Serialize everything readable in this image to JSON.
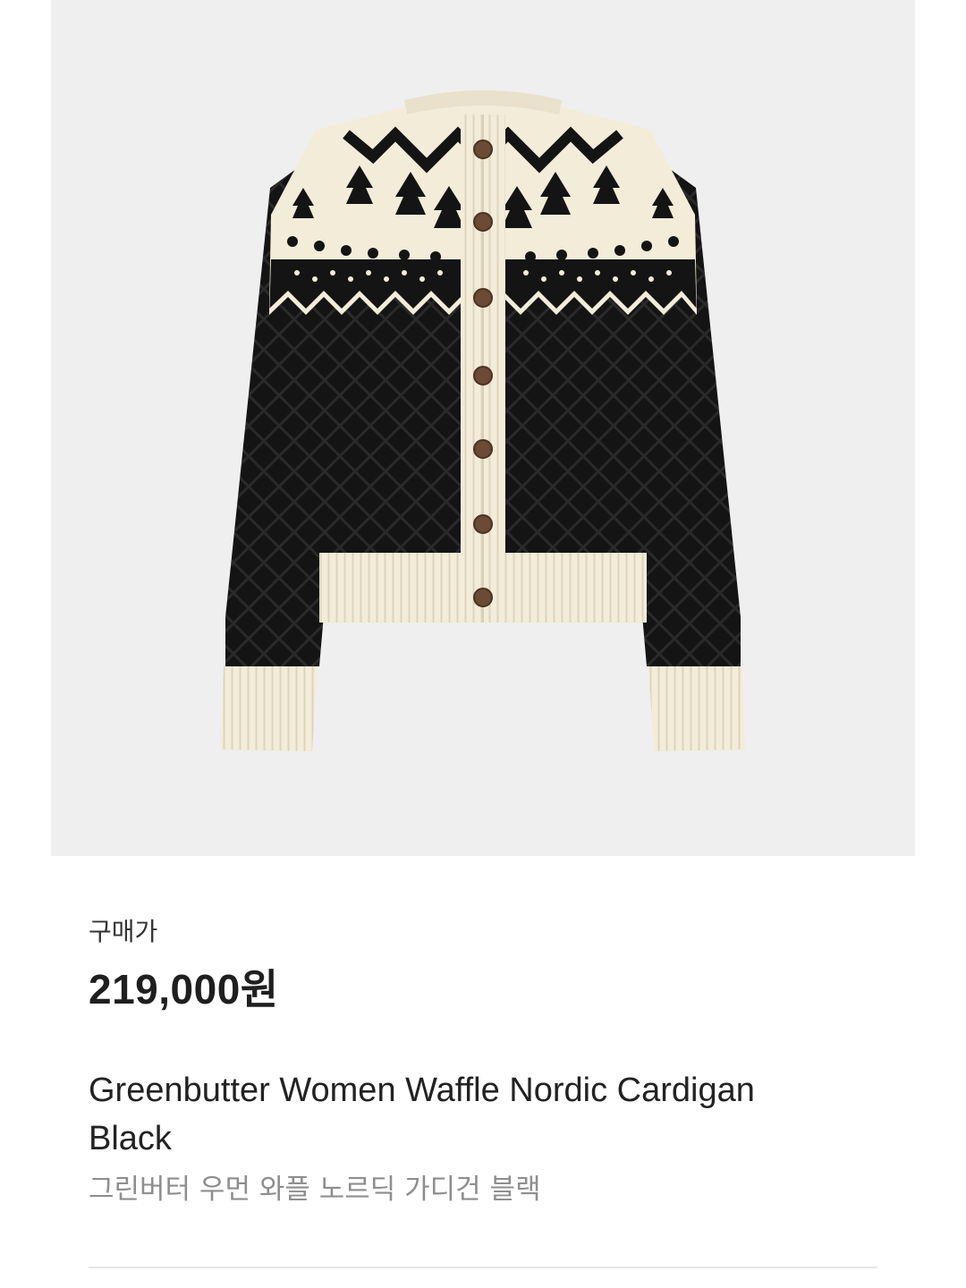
{
  "product": {
    "image_alt": "Greenbutter Women Waffle Nordic Cardigan Black",
    "price_label": "구매가",
    "price": "219,000원",
    "name_en": "Greenbutter Women Waffle Nordic Cardigan Black",
    "name_ko": "그린버터 우먼 와플 노르딕 가디건 블랙"
  },
  "colors": {
    "image_background": "#efefef",
    "knit_black": "#141414",
    "knit_cream": "#f3ecd9",
    "button_brown": "#6b4a36",
    "label_green": "#39c84a"
  }
}
